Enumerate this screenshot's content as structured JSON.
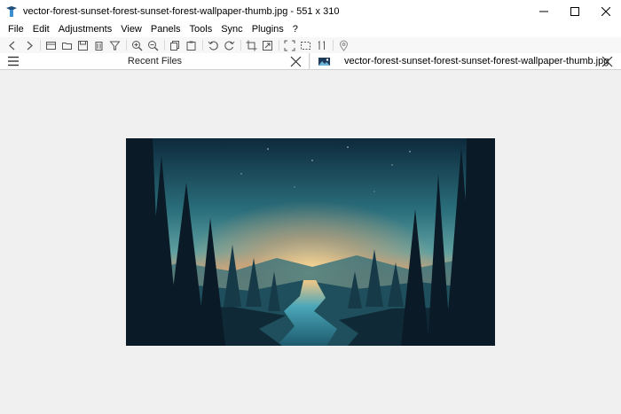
{
  "window": {
    "title": "vector-forest-sunset-forest-sunset-forest-wallpaper-thumb.jpg - 551 x 310",
    "app_icon": "app-logo-icon",
    "controls": [
      "minimize-icon",
      "maximize-icon",
      "close-icon"
    ]
  },
  "menu": {
    "items": [
      "File",
      "Edit",
      "Adjustments",
      "View",
      "Panels",
      "Tools",
      "Sync",
      "Plugins",
      "?"
    ]
  },
  "toolbar": {
    "icons": [
      "back-icon",
      "forward-icon",
      "open-file-icon",
      "open-folder-icon",
      "save-icon",
      "delete-icon",
      "filter-icon",
      "zoom-in-icon",
      "zoom-out-icon",
      "copy-icon",
      "paste-icon",
      "rotate-left-icon",
      "rotate-right-icon",
      "crop-icon",
      "resize-icon",
      "fit-screen-icon",
      "selection-icon",
      "actual-size-icon",
      "location-icon"
    ]
  },
  "panel": {
    "title": "Recent Files",
    "menu_icon": "hamburger-menu-icon",
    "close_icon": "close-icon"
  },
  "tab": {
    "title": "vector-forest-sunset-forest-sunset-forest-wallpaper-thumb.jpg",
    "icon": "image-file-icon",
    "close_icon": "close-icon"
  },
  "viewer": {
    "background": "#f0f0f0",
    "image": {
      "subject": "vector forest sunset illustration",
      "colors": {
        "sky_top": "#0d2a3c",
        "sky_mid": "#3f8a93",
        "glow": "#f0b86a",
        "sun": "#ffd98a",
        "trees": "#0a1a26",
        "river": "#4aa7b8"
      }
    }
  }
}
